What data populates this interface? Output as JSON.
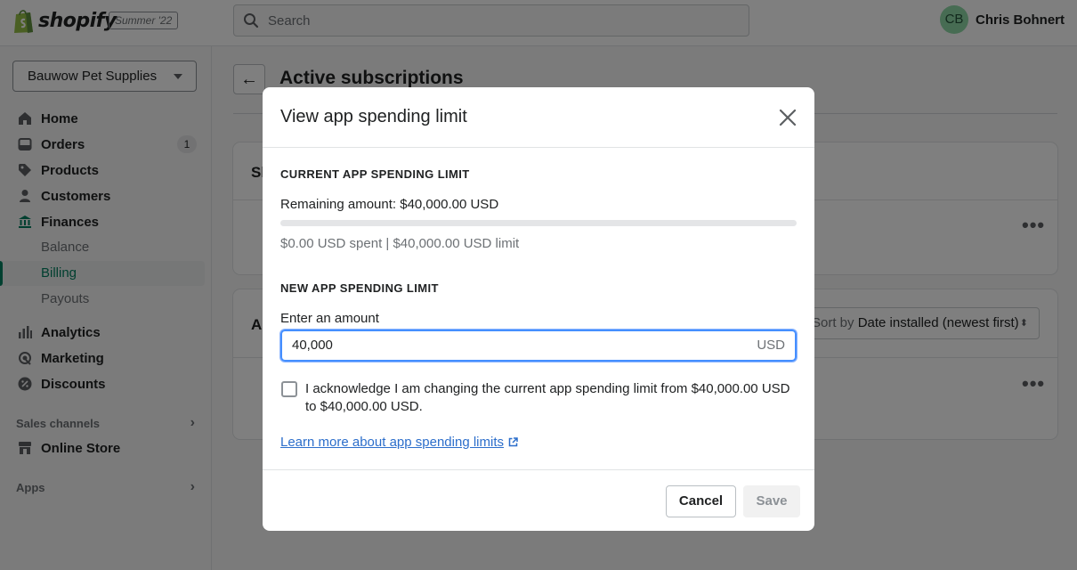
{
  "topbar": {
    "brand": "shopify",
    "edition": "Summer '22",
    "search_placeholder": "Search",
    "user_initials": "CB",
    "user_name": "Chris Bohnert"
  },
  "sidebar": {
    "store_name": "Bauwow Pet Supplies",
    "items": [
      {
        "label": "Home"
      },
      {
        "label": "Orders",
        "badge": "1"
      },
      {
        "label": "Products"
      },
      {
        "label": "Customers"
      },
      {
        "label": "Finances"
      }
    ],
    "finance_sub": [
      {
        "label": "Balance"
      },
      {
        "label": "Billing"
      },
      {
        "label": "Payouts"
      }
    ],
    "items2": [
      {
        "label": "Analytics"
      },
      {
        "label": "Marketing"
      },
      {
        "label": "Discounts"
      }
    ],
    "sales_channels_heading": "Sales channels",
    "online_store": "Online Store",
    "apps_heading": "Apps"
  },
  "main": {
    "page_title": "Active subscriptions",
    "card1_title_fragment": "Sh",
    "card2_title_fragment": "Ap",
    "sort_label": "Sort by",
    "sort_value": "Date installed (newest first)"
  },
  "modal": {
    "title": "View app spending limit",
    "current_heading": "CURRENT APP SPENDING LIMIT",
    "remaining": "Remaining amount: $40,000.00 USD",
    "spent_fraction": 0,
    "spent_summary": "$0.00 USD spent | $40,000.00 USD limit",
    "new_heading": "NEW APP SPENDING LIMIT",
    "amount_label": "Enter an amount",
    "amount_value": "40,000",
    "amount_suffix": "USD",
    "acknowledge_text": "I acknowledge I am changing the current app spending limit from $40,000.00 USD to $40,000.00 USD.",
    "acknowledge_checked": false,
    "learn_more": "Learn more about app spending limits",
    "cancel_label": "Cancel",
    "save_label": "Save"
  },
  "colors": {
    "link": "#2c6ecb",
    "focus": "#458fff",
    "brand_green": "#008060"
  }
}
